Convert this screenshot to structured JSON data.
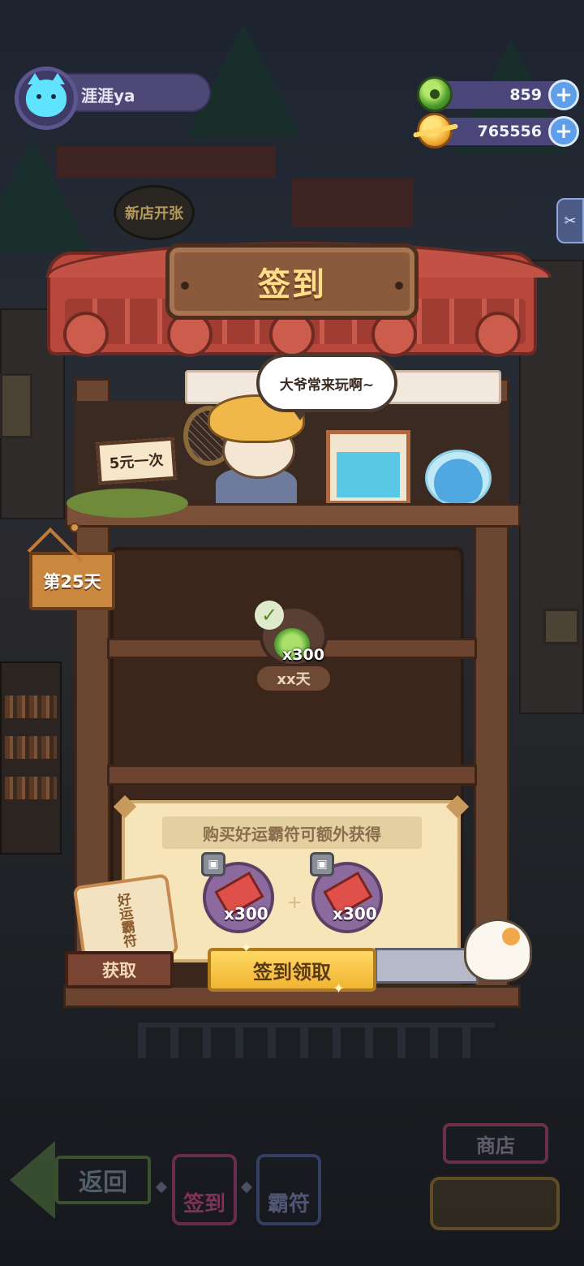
{
  "player": {
    "name": "涯涯ya",
    "avatar_icon": "cat-avatar-icon"
  },
  "currencies": [
    {
      "name": "green-gem",
      "value": "859",
      "color": "#4e9b2e"
    },
    {
      "name": "gold-coin",
      "value": "765556",
      "color": "#f0a52e"
    }
  ],
  "background": {
    "shop_bubble": "新店开张"
  },
  "modal": {
    "title": "签到",
    "speech": "大爷常来玩啊~",
    "sign_text": "5元一次",
    "day_label": "第25天",
    "reward": {
      "qty": "x300",
      "day": "xx天",
      "claimed": true
    },
    "panel": {
      "banner": "购买好运霸符可额外获得",
      "tickets": [
        {
          "qty": "x300",
          "locked": true
        },
        {
          "qty": "x300",
          "locked": true
        }
      ]
    },
    "charm_label": "好运霸符",
    "get_button": "获取",
    "checkin_button": "签到领取"
  },
  "nav": {
    "back": "返回",
    "checkin": "签到",
    "charm": "霸符",
    "shop": "商店"
  },
  "colors": {
    "accent_gold": "#ffde87",
    "wood": "#6c4430",
    "roof": "#b9473b",
    "parchment": "#f7e4b8"
  }
}
